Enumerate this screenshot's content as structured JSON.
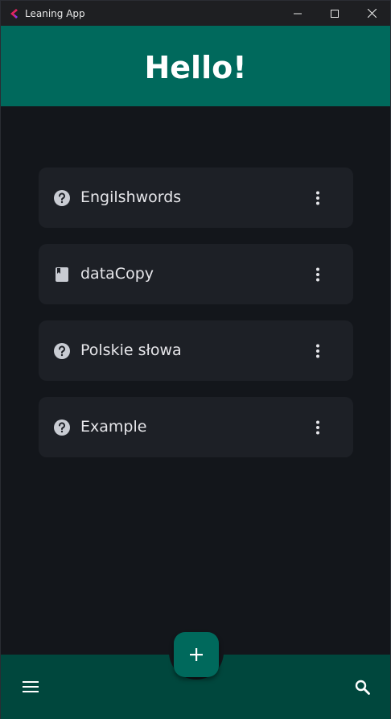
{
  "window": {
    "title": "Leaning App",
    "controls": [
      "minimize-icon",
      "maximize-icon",
      "close-icon"
    ]
  },
  "header": {
    "title": "Hello!"
  },
  "items": [
    {
      "label": "Engilshwords",
      "icon": "help-circle-icon"
    },
    {
      "label": "dataCopy",
      "icon": "book-icon"
    },
    {
      "label": "Polskie słowa",
      "icon": "help-circle-icon"
    },
    {
      "label": "Example",
      "icon": "help-circle-icon"
    }
  ],
  "bottom_bar": {
    "left_icon": "menu-icon",
    "fab_icon": "plus-icon",
    "right_icon": "search-icon"
  },
  "colors": {
    "primary": "#00695c",
    "bottom_bar": "#00473d",
    "background": "#13161b",
    "card": "#1d2026"
  }
}
